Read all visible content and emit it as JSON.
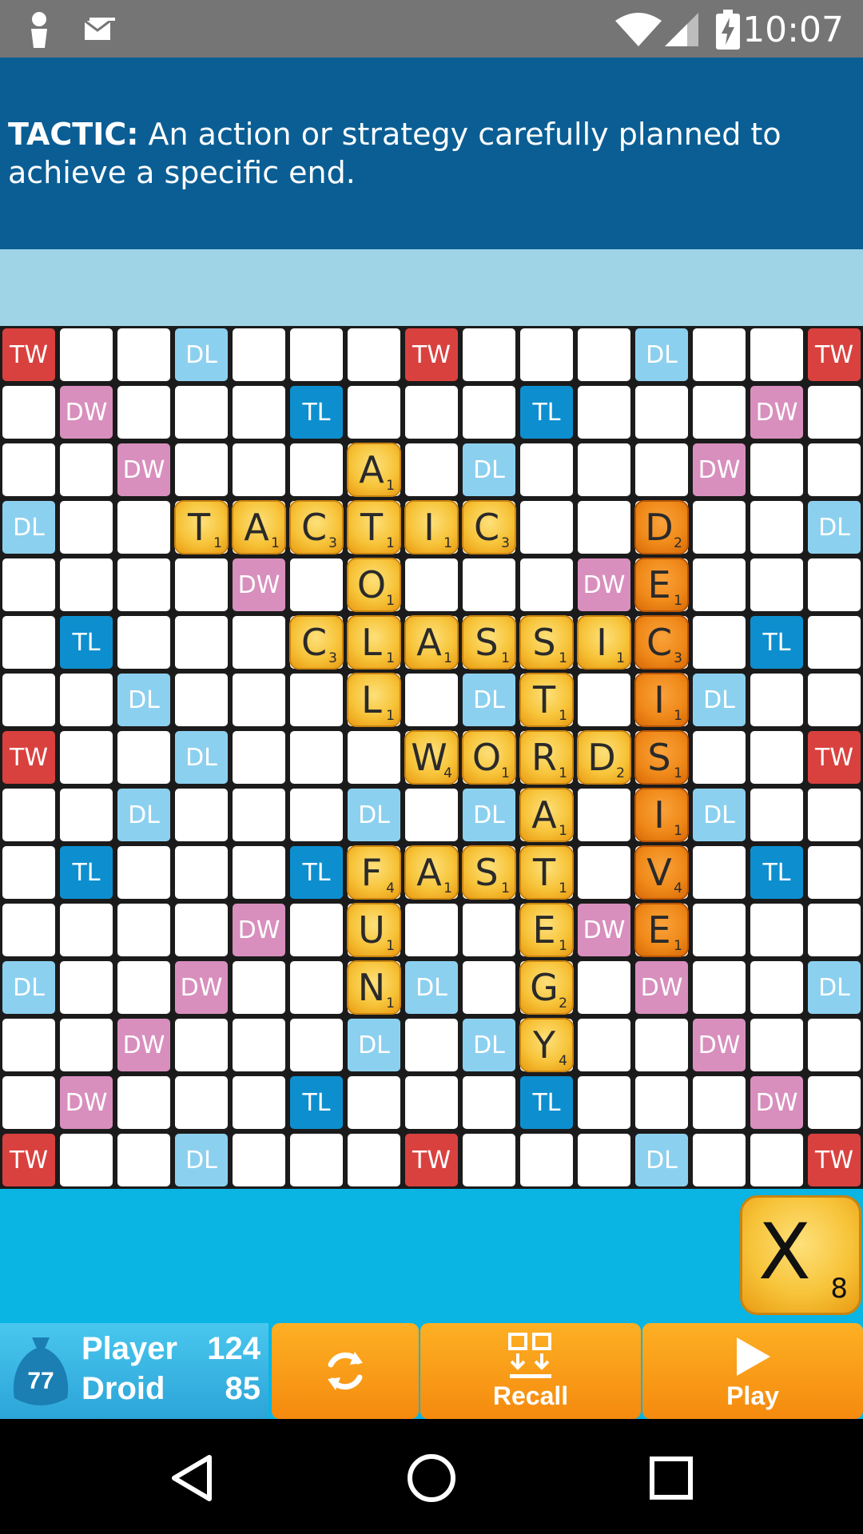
{
  "status_bar": {
    "time": "10:07"
  },
  "definition": {
    "term": "TACTIC:",
    "text": " An action or strategy carefully planned to achieve a specific end."
  },
  "board": {
    "premium_squares": [
      {
        "r": 0,
        "c": 0,
        "t": "TW"
      },
      {
        "r": 0,
        "c": 3,
        "t": "DL"
      },
      {
        "r": 0,
        "c": 7,
        "t": "TW"
      },
      {
        "r": 0,
        "c": 11,
        "t": "DL"
      },
      {
        "r": 0,
        "c": 14,
        "t": "TW"
      },
      {
        "r": 1,
        "c": 1,
        "t": "DW"
      },
      {
        "r": 1,
        "c": 5,
        "t": "TL"
      },
      {
        "r": 1,
        "c": 9,
        "t": "TL"
      },
      {
        "r": 1,
        "c": 13,
        "t": "DW"
      },
      {
        "r": 2,
        "c": 2,
        "t": "DW"
      },
      {
        "r": 2,
        "c": 8,
        "t": "DL"
      },
      {
        "r": 2,
        "c": 12,
        "t": "DW"
      },
      {
        "r": 3,
        "c": 0,
        "t": "DL"
      },
      {
        "r": 3,
        "c": 14,
        "t": "DL"
      },
      {
        "r": 4,
        "c": 4,
        "t": "DW"
      },
      {
        "r": 4,
        "c": 10,
        "t": "DW"
      },
      {
        "r": 5,
        "c": 1,
        "t": "TL"
      },
      {
        "r": 5,
        "c": 13,
        "t": "TL"
      },
      {
        "r": 6,
        "c": 2,
        "t": "DL"
      },
      {
        "r": 6,
        "c": 8,
        "t": "DL"
      },
      {
        "r": 6,
        "c": 12,
        "t": "DL"
      },
      {
        "r": 7,
        "c": 0,
        "t": "TW"
      },
      {
        "r": 7,
        "c": 3,
        "t": "DL"
      },
      {
        "r": 7,
        "c": 14,
        "t": "TW"
      },
      {
        "r": 8,
        "c": 2,
        "t": "DL"
      },
      {
        "r": 8,
        "c": 6,
        "t": "DL"
      },
      {
        "r": 8,
        "c": 8,
        "t": "DL"
      },
      {
        "r": 8,
        "c": 12,
        "t": "DL"
      },
      {
        "r": 9,
        "c": 1,
        "t": "TL"
      },
      {
        "r": 9,
        "c": 5,
        "t": "TL"
      },
      {
        "r": 9,
        "c": 13,
        "t": "TL"
      },
      {
        "r": 10,
        "c": 4,
        "t": "DW"
      },
      {
        "r": 10,
        "c": 10,
        "t": "DW"
      },
      {
        "r": 11,
        "c": 0,
        "t": "DL"
      },
      {
        "r": 11,
        "c": 3,
        "t": "DW"
      },
      {
        "r": 11,
        "c": 7,
        "t": "DL"
      },
      {
        "r": 11,
        "c": 11,
        "t": "DW"
      },
      {
        "r": 11,
        "c": 14,
        "t": "DL"
      },
      {
        "r": 12,
        "c": 2,
        "t": "DW"
      },
      {
        "r": 12,
        "c": 6,
        "t": "DL"
      },
      {
        "r": 12,
        "c": 8,
        "t": "DL"
      },
      {
        "r": 12,
        "c": 12,
        "t": "DW"
      },
      {
        "r": 13,
        "c": 1,
        "t": "DW"
      },
      {
        "r": 13,
        "c": 5,
        "t": "TL"
      },
      {
        "r": 13,
        "c": 9,
        "t": "TL"
      },
      {
        "r": 13,
        "c": 13,
        "t": "DW"
      },
      {
        "r": 14,
        "c": 0,
        "t": "TW"
      },
      {
        "r": 14,
        "c": 3,
        "t": "DL"
      },
      {
        "r": 14,
        "c": 7,
        "t": "TW"
      },
      {
        "r": 14,
        "c": 11,
        "t": "DL"
      },
      {
        "r": 14,
        "c": 14,
        "t": "TW"
      }
    ],
    "tiles": [
      {
        "r": 2,
        "c": 6,
        "l": "A",
        "p": "1"
      },
      {
        "r": 3,
        "c": 3,
        "l": "T",
        "p": "1"
      },
      {
        "r": 3,
        "c": 4,
        "l": "A",
        "p": "1"
      },
      {
        "r": 3,
        "c": 5,
        "l": "C",
        "p": "3"
      },
      {
        "r": 3,
        "c": 6,
        "l": "T",
        "p": "1"
      },
      {
        "r": 3,
        "c": 7,
        "l": "I",
        "p": "1"
      },
      {
        "r": 3,
        "c": 8,
        "l": "C",
        "p": "3"
      },
      {
        "r": 3,
        "c": 11,
        "l": "D",
        "p": "2",
        "hl": true
      },
      {
        "r": 4,
        "c": 6,
        "l": "O",
        "p": "1"
      },
      {
        "r": 4,
        "c": 11,
        "l": "E",
        "p": "1",
        "hl": true
      },
      {
        "r": 5,
        "c": 5,
        "l": "C",
        "p": "3"
      },
      {
        "r": 5,
        "c": 6,
        "l": "L",
        "p": "1"
      },
      {
        "r": 5,
        "c": 7,
        "l": "A",
        "p": "1"
      },
      {
        "r": 5,
        "c": 8,
        "l": "S",
        "p": "1"
      },
      {
        "r": 5,
        "c": 9,
        "l": "S",
        "p": "1"
      },
      {
        "r": 5,
        "c": 10,
        "l": "I",
        "p": "1"
      },
      {
        "r": 5,
        "c": 11,
        "l": "C",
        "p": "3",
        "hl": true
      },
      {
        "r": 6,
        "c": 6,
        "l": "L",
        "p": "1"
      },
      {
        "r": 6,
        "c": 9,
        "l": "T",
        "p": "1"
      },
      {
        "r": 6,
        "c": 11,
        "l": "I",
        "p": "1",
        "hl": true
      },
      {
        "r": 7,
        "c": 7,
        "l": "W",
        "p": "4"
      },
      {
        "r": 7,
        "c": 8,
        "l": "O",
        "p": "1"
      },
      {
        "r": 7,
        "c": 9,
        "l": "R",
        "p": "1"
      },
      {
        "r": 7,
        "c": 10,
        "l": "D",
        "p": "2"
      },
      {
        "r": 7,
        "c": 11,
        "l": "S",
        "p": "1",
        "hl": true
      },
      {
        "r": 8,
        "c": 9,
        "l": "A",
        "p": "1"
      },
      {
        "r": 8,
        "c": 11,
        "l": "I",
        "p": "1",
        "hl": true
      },
      {
        "r": 9,
        "c": 6,
        "l": "F",
        "p": "4"
      },
      {
        "r": 9,
        "c": 7,
        "l": "A",
        "p": "1"
      },
      {
        "r": 9,
        "c": 8,
        "l": "S",
        "p": "1"
      },
      {
        "r": 9,
        "c": 9,
        "l": "T",
        "p": "1"
      },
      {
        "r": 9,
        "c": 11,
        "l": "V",
        "p": "4",
        "hl": true
      },
      {
        "r": 10,
        "c": 6,
        "l": "U",
        "p": "1"
      },
      {
        "r": 10,
        "c": 9,
        "l": "E",
        "p": "1"
      },
      {
        "r": 10,
        "c": 11,
        "l": "E",
        "p": "1",
        "hl": true
      },
      {
        "r": 11,
        "c": 6,
        "l": "N",
        "p": "1"
      },
      {
        "r": 11,
        "c": 9,
        "l": "G",
        "p": "2"
      },
      {
        "r": 12,
        "c": 9,
        "l": "Y",
        "p": "4"
      }
    ]
  },
  "rack": {
    "tile": {
      "letter": "X",
      "points": "8"
    }
  },
  "scoreboard": {
    "bag_count": "77",
    "player_label": "Player",
    "player_score": "124",
    "droid_label": "Droid",
    "droid_score": "85"
  },
  "buttons": {
    "recall_label": "Recall",
    "play_label": "Play"
  },
  "icons": {
    "status_left": [
      "person-icon",
      "mail-icon"
    ],
    "status_right": [
      "wifi-icon",
      "signal-icon",
      "battery-charging-icon"
    ],
    "swap": "refresh-icon",
    "recall": "recall-icon",
    "play": "play-icon",
    "nav": [
      "back-icon",
      "home-icon",
      "recents-icon"
    ]
  }
}
